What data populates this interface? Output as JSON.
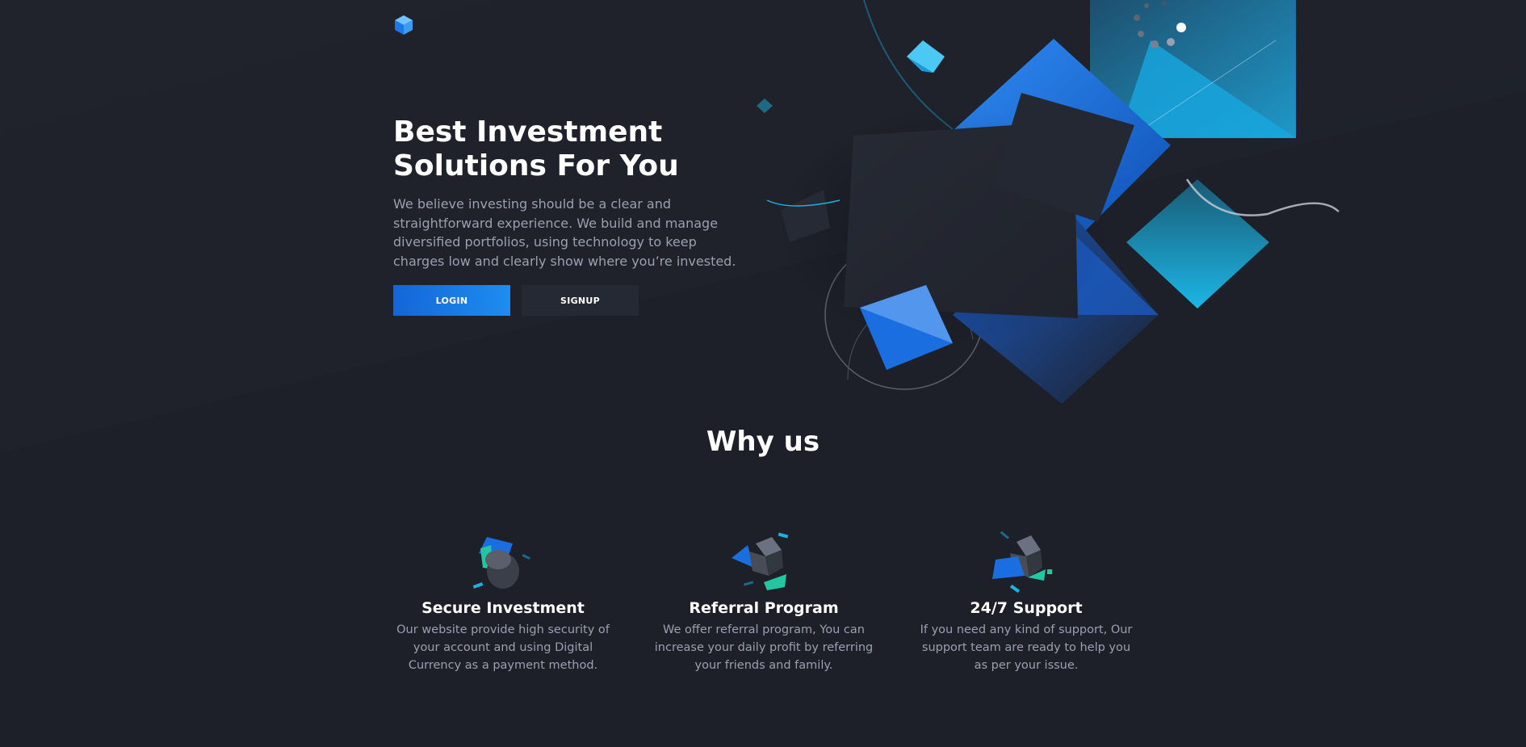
{
  "header": {
    "logo_icon": "cube-logo-icon"
  },
  "hero": {
    "title": "Best Investment Solutions For You",
    "description": "We believe investing should be a clear and straightforward experience. We build and manage diversified portfolios, using technology to keep charges low and clearly show where you’re invested.",
    "login_label": "LOGIN",
    "signup_label": "SIGNUP"
  },
  "why": {
    "title": "Why us",
    "features": [
      {
        "icon": "cylinder-shield-icon",
        "title": "Secure Investment",
        "text": "Our website provide high security of your account and using Digital Currency as a payment method."
      },
      {
        "icon": "cube-referral-icon",
        "title": "Referral Program",
        "text": "We offer referral program, You can increase your daily profit by referring your friends and family."
      },
      {
        "icon": "cube-support-icon",
        "title": "24/7 Support",
        "text": "If you need any kind of support, Our support team are ready to help you as per your issue."
      }
    ]
  },
  "colors": {
    "background": "#1d2029",
    "accent_blue": "#1466d8",
    "accent_cyan": "#1cb2e6",
    "accent_teal": "#23c6a0",
    "text_muted": "#9aa0b0"
  }
}
